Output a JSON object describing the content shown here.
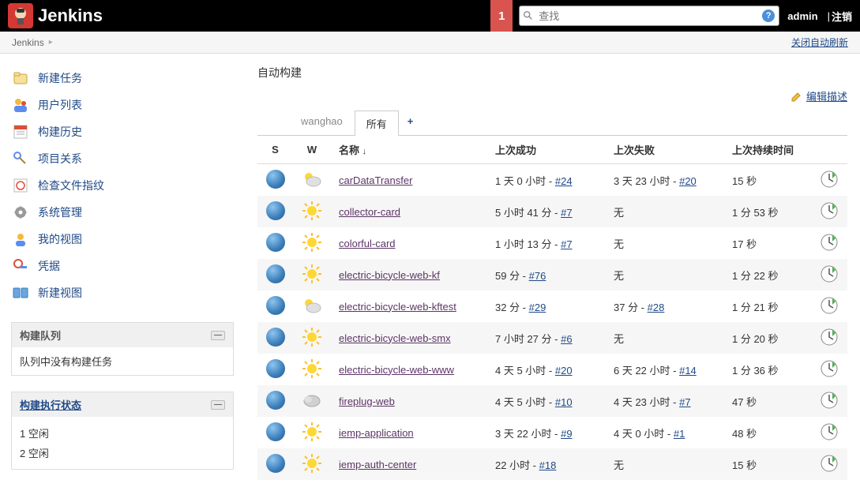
{
  "header": {
    "app_name": "Jenkins",
    "notif_count": "1",
    "search_placeholder": "查找",
    "user": "admin",
    "logout": "注销"
  },
  "breadcrumb": {
    "root": "Jenkins"
  },
  "auto_refresh_label": "关闭自动刷新",
  "sidebar": {
    "items": [
      {
        "icon": "new-item",
        "label": "新建任务"
      },
      {
        "icon": "people",
        "label": "用户列表"
      },
      {
        "icon": "history",
        "label": "构建历史"
      },
      {
        "icon": "relation",
        "label": "项目关系"
      },
      {
        "icon": "fingerprint",
        "label": "检查文件指纹"
      },
      {
        "icon": "manage",
        "label": "系统管理"
      },
      {
        "icon": "my-views",
        "label": "我的视图"
      },
      {
        "icon": "credentials",
        "label": "凭据"
      },
      {
        "icon": "new-view",
        "label": "新建视图"
      }
    ],
    "queue_title": "构建队列",
    "queue_empty": "队列中没有构建任务",
    "exec_title": "构建执行状态",
    "executors": [
      {
        "num": "1",
        "state": "空闲"
      },
      {
        "num": "2",
        "state": "空闲"
      }
    ]
  },
  "content": {
    "page_title": "自动构建",
    "edit_description": "编辑描述",
    "tabs": [
      {
        "label": "wanghao",
        "active": false
      },
      {
        "label": "所有",
        "active": true
      }
    ],
    "add_tab": "+",
    "columns": {
      "s": "S",
      "w": "W",
      "name": "名称",
      "last_success": "上次成功",
      "last_failure": "上次失败",
      "duration": "上次持续时间"
    },
    "none_label": "无",
    "jobs": [
      {
        "name": "carDataTransfer",
        "weather": "partly",
        "last_success": "1 天 0 小时",
        "success_build": "#24",
        "last_failure": "3 天 23 小时",
        "failure_build": "#20",
        "duration": "15 秒"
      },
      {
        "name": "collector-card",
        "weather": "sun",
        "last_success": "5 小时 41 分",
        "success_build": "#7",
        "last_failure": "",
        "failure_build": "",
        "duration": "1 分 53 秒"
      },
      {
        "name": "colorful-card",
        "weather": "sun",
        "last_success": "1 小时 13 分",
        "success_build": "#7",
        "last_failure": "",
        "failure_build": "",
        "duration": "17 秒"
      },
      {
        "name": "electric-bicycle-web-kf",
        "weather": "sun",
        "last_success": "59 分",
        "success_build": "#76",
        "last_failure": "",
        "failure_build": "",
        "duration": "1 分 22 秒"
      },
      {
        "name": "electric-bicycle-web-kftest",
        "weather": "partly",
        "last_success": "32 分",
        "success_build": "#29",
        "last_failure": "37 分",
        "failure_build": "#28",
        "duration": "1 分 21 秒"
      },
      {
        "name": "electric-bicycle-web-smx",
        "weather": "sun",
        "last_success": "7 小时 27 分",
        "success_build": "#6",
        "last_failure": "",
        "failure_build": "",
        "duration": "1 分 20 秒"
      },
      {
        "name": "electric-bicycle-web-www",
        "weather": "sun",
        "last_success": "4 天 5 小时",
        "success_build": "#20",
        "last_failure": "6 天 22 小时",
        "failure_build": "#14",
        "duration": "1 分 36 秒"
      },
      {
        "name": "fireplug-web",
        "weather": "cloud",
        "last_success": "4 天 5 小时",
        "success_build": "#10",
        "last_failure": "4 天 23 小时",
        "failure_build": "#7",
        "duration": "47 秒"
      },
      {
        "name": "iemp-application",
        "weather": "sun",
        "last_success": "3 天 22 小时",
        "success_build": "#9",
        "last_failure": "4 天 0 小时",
        "failure_build": "#1",
        "duration": "48 秒"
      },
      {
        "name": "iemp-auth-center",
        "weather": "sun",
        "last_success": "22 小时",
        "success_build": "#18",
        "last_failure": "",
        "failure_build": "",
        "duration": "15 秒"
      }
    ]
  }
}
